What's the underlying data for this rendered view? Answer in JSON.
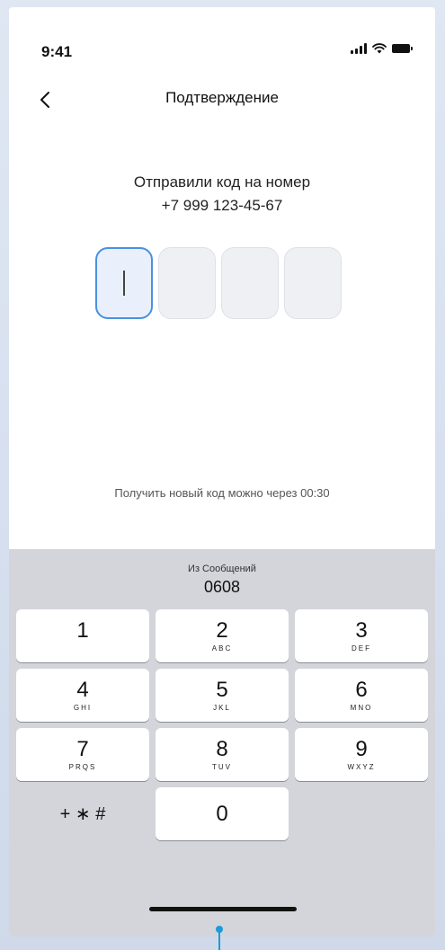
{
  "status_bar": {
    "time": "9:41"
  },
  "nav": {
    "title": "Подтверждение"
  },
  "message": {
    "line1": "Отправили код на номер",
    "line2": "+7 999 123-45-67"
  },
  "code": {
    "digits": [
      "",
      "",
      "",
      ""
    ],
    "active_index": 0
  },
  "resend": {
    "text": "Получить новый код можно через 00:30"
  },
  "keyboard": {
    "suggestion_label": "Из Сообщений",
    "suggestion_code": "0608",
    "keys": [
      {
        "digit": "1",
        "letters": ""
      },
      {
        "digit": "2",
        "letters": "ABC"
      },
      {
        "digit": "3",
        "letters": "DEF"
      },
      {
        "digit": "4",
        "letters": "GHI"
      },
      {
        "digit": "5",
        "letters": "JKL"
      },
      {
        "digit": "6",
        "letters": "MNO"
      },
      {
        "digit": "7",
        "letters": "PRQS"
      },
      {
        "digit": "8",
        "letters": "TUV"
      },
      {
        "digit": "9",
        "letters": "WXYZ"
      },
      {
        "digit": "+ ∗ #",
        "letters": ""
      },
      {
        "digit": "0",
        "letters": ""
      }
    ]
  },
  "colors": {
    "accent": "#4a90e2",
    "keyboard_bg": "#d3d5db"
  },
  "icons": {
    "back": "chevron-left-icon",
    "signal": "cellular-signal-icon",
    "wifi": "wifi-icon",
    "battery": "battery-icon"
  }
}
